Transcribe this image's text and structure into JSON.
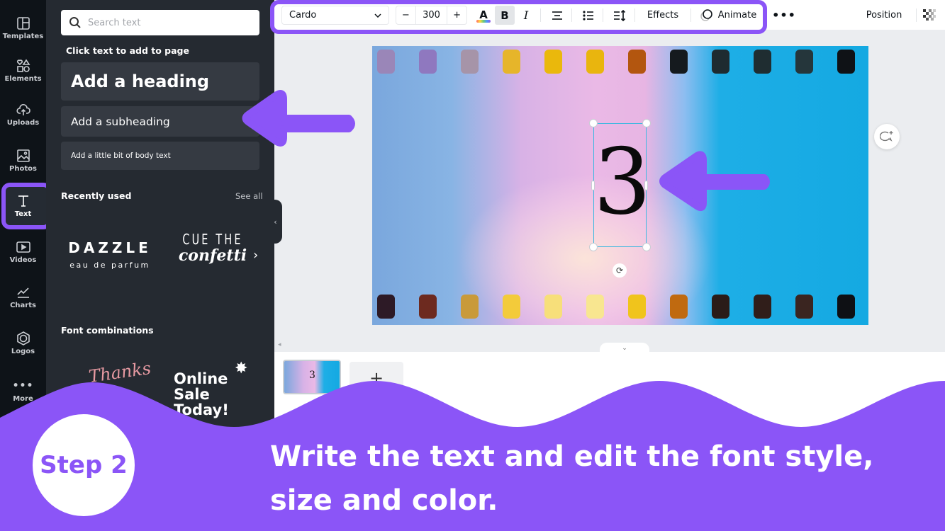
{
  "rail": {
    "items": [
      {
        "label": "Templates",
        "icon": "templates-icon"
      },
      {
        "label": "Elements",
        "icon": "elements-icon"
      },
      {
        "label": "Uploads",
        "icon": "upload-cloud-icon"
      },
      {
        "label": "Photos",
        "icon": "photo-icon"
      },
      {
        "label": "Text",
        "icon": "text-t-icon",
        "active": true
      },
      {
        "label": "Videos",
        "icon": "video-icon"
      },
      {
        "label": "Charts",
        "icon": "chart-line-icon"
      },
      {
        "label": "Logos",
        "icon": "logo-badge-icon"
      },
      {
        "label": "More",
        "icon": "more-dots-icon"
      }
    ]
  },
  "panel": {
    "search_placeholder": "Search text",
    "click_label": "Click text to add to page",
    "add_heading": "Add a heading",
    "add_subheading": "Add a subheading",
    "add_body": "Add a little bit of body text",
    "recently_used": "Recently used",
    "see_all": "See all",
    "recent": [
      {
        "line1": "DAZZLE",
        "line2": "eau de parfum"
      },
      {
        "line1": "CUE THE",
        "line2": "confetti"
      }
    ],
    "font_combinations": "Font combinations",
    "combos": [
      {
        "text": "Thanks"
      },
      {
        "line1": "Online",
        "line2": "Sale",
        "line3": "Today!"
      }
    ]
  },
  "toolbar": {
    "font": "Cardo",
    "size_minus": "−",
    "size": "300",
    "size_plus": "+",
    "text_color_glyph": "A",
    "bold": "B",
    "italic": "I",
    "effects": "Effects",
    "animate": "Animate",
    "more": "•••",
    "position": "Position"
  },
  "canvas": {
    "text": "3",
    "top_sprockets": [
      "#9a86b8",
      "#8f78bf",
      "#a694a8",
      "#e6b52a",
      "#eab80c",
      "#e9b50e",
      "#b3560f",
      "#151a1e",
      "#1e2b30",
      "#1f2d31",
      "#25363b",
      "#0f1216"
    ],
    "bottom_sprockets": [
      "#2d1a26",
      "#6d2a1f",
      "#c99a3a",
      "#f3cb3a",
      "#f7df7a",
      "#f8e690",
      "#f0c41c",
      "#c06a10",
      "#2a1c18",
      "#301e1a",
      "#3a2520",
      "#0e1014"
    ]
  },
  "pages": {
    "thumb_text": "3",
    "add_page": "+"
  },
  "overlay": {
    "step_label": "Step 2",
    "caption_line1": "Write the text and edit the font style,",
    "caption_line2": "size and color.",
    "accent_color": "#8b55f7"
  }
}
